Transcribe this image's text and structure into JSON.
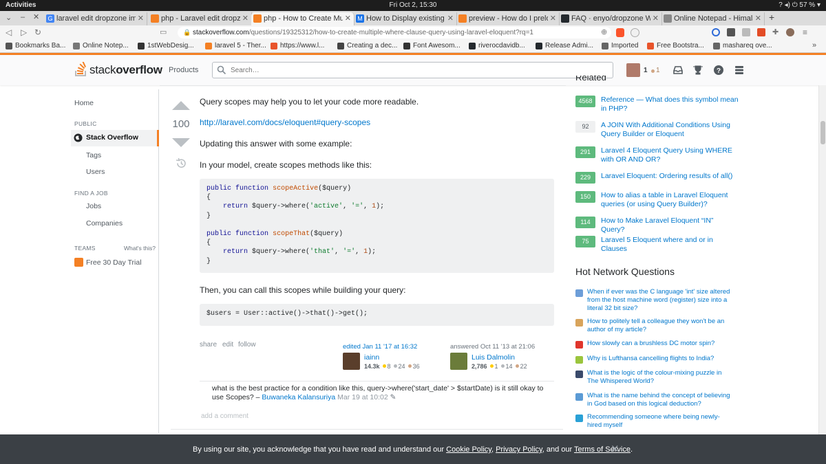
{
  "os": {
    "activities": "Activities",
    "clock": "Fri Oct  2, 15:30",
    "battery": "57 %"
  },
  "tabs": [
    {
      "label": "laravel edit dropzone imag",
      "fav_color": "#4285f4",
      "fav": "G"
    },
    {
      "label": "php - Laravel edit dropzone",
      "fav_color": "#f48024",
      "fav": ""
    },
    {
      "label": "php - How to Create Multip",
      "fav_color": "#f48024",
      "fav": ""
    },
    {
      "label": "How to Display existing fil",
      "fav_color": "#1a73e8",
      "fav": "M"
    },
    {
      "label": "preview - How do I preload",
      "fav_color": "#f48024",
      "fav": ""
    },
    {
      "label": "FAQ · enyo/dropzone Wiki",
      "fav_color": "#24292e",
      "fav": ""
    },
    {
      "label": "Online Notepad - Himalaya",
      "fav_color": "#888888",
      "fav": ""
    }
  ],
  "address": {
    "host": "stackoverflow.com",
    "path": "/questions/19325312/how-to-create-multiple-where-clause-query-using-laravel-eloquent?rq=1"
  },
  "bookmarks": [
    {
      "label": "Bookmarks Ba...",
      "color": "#555555"
    },
    {
      "label": "Online Notep...",
      "color": "#777777"
    },
    {
      "label": "1stWebDesig...",
      "color": "#333333"
    },
    {
      "label": "laravel 5 - Ther...",
      "color": "#f48024"
    },
    {
      "label": "https://www.l...",
      "color": "#e8542b"
    },
    {
      "label": "Creating a dec...",
      "color": "#444444"
    },
    {
      "label": "Font Awesom...",
      "color": "#333333"
    },
    {
      "label": "riverocdavidb...",
      "color": "#24292e"
    },
    {
      "label": "Release Admi...",
      "color": "#24292e"
    },
    {
      "label": "Imported",
      "color": "#666666"
    },
    {
      "label": "Free Bootstra...",
      "color": "#e8542b"
    },
    {
      "label": "mashareq ove...",
      "color": "#666666"
    }
  ],
  "header": {
    "logo_a": "stack",
    "logo_b": "overflow",
    "products": "Products",
    "search_placeholder": "Search…",
    "rep": "1",
    "bronze": "1"
  },
  "leftnav": {
    "home": "Home",
    "public": "PUBLIC",
    "stack_overflow": "Stack Overflow",
    "tags": "Tags",
    "users": "Users",
    "find_a_job": "FIND A JOB",
    "jobs": "Jobs",
    "companies": "Companies",
    "teams": "TEAMS",
    "whats_this": "What's this?",
    "trial": "Free 30 Day Trial"
  },
  "answer": {
    "score": "100",
    "p1": "Query scopes may help you to let your code more readable.",
    "link": "http://laravel.com/docs/eloquent#query-scopes",
    "p2": "Updating this answer with some example:",
    "p3": "In your model, create scopes methods like this:",
    "p4": "Then, you can call this scopes while building your query:",
    "code2": "$users = User::active()->that()->get();",
    "share": "share",
    "edit": "edit",
    "follow": "follow",
    "edited": "edited Jan 11 '17 at 16:32",
    "editor": {
      "name": "iainn",
      "rep": "14.3k",
      "gold": "8",
      "silver": "24",
      "bronze": "36"
    },
    "answered": "answered Oct 11 '13 at 21:06",
    "author": {
      "name": "Luis Dalmolin",
      "rep": "2,786",
      "gold": "1",
      "silver": "14",
      "bronze": "22"
    },
    "comment_text": "what is the best practice for a condition like this, query->where('start_date' > $startDate) is it still okay to use Scopes?",
    "comment_user": "Buwaneka Kalansuriya",
    "comment_date": "Mar 19 at 10:02",
    "add_comment": "add a comment"
  },
  "sidebar": {
    "related_title": "Related",
    "related": [
      {
        "score": "4568",
        "accepted": true,
        "text": "Reference — What does this symbol mean in PHP?"
      },
      {
        "score": "92",
        "accepted": false,
        "text": "A JOIN With Additional Conditions Using Query Builder or Eloquent"
      },
      {
        "score": "291",
        "accepted": true,
        "text": "Laravel 4 Eloquent Query Using WHERE with OR AND OR?"
      },
      {
        "score": "229",
        "accepted": true,
        "text": "Laravel Eloquent: Ordering results of all()"
      },
      {
        "score": "150",
        "accepted": true,
        "text": "How to alias a table in Laravel Eloquent queries (or using Query Builder)?"
      },
      {
        "score": "114",
        "accepted": true,
        "text": "How to Make Laravel Eloquent “IN” Query?"
      },
      {
        "score": "75",
        "accepted": true,
        "text": "Laravel 5 Eloquent where and or in Clauses"
      }
    ],
    "hnq_title": "Hot Network Questions",
    "hnq": [
      {
        "text": "When if ever was the C language 'int' size altered from the host machine word (register) size into a literal 32 bit size?",
        "color": "#6d9ed8"
      },
      {
        "text": "How to politely tell a colleague they won't be an author of my article?",
        "color": "#d8a45c"
      },
      {
        "text": "How slowly can a brushless DC motor spin?",
        "color": "#e0362d"
      },
      {
        "text": "Why is Lufthansa cancelling flights to India?",
        "color": "#9bc53d"
      },
      {
        "text": "What is the logic of the colour-mixing puzzle in The Whispered World?",
        "color": "#3a4a6b"
      },
      {
        "text": "What is the name behind the concept of believing in God based on this logical deduction?",
        "color": "#5b9bd5"
      },
      {
        "text": "Recommending someone where being newly-hired myself",
        "color": "#2aa1d6"
      }
    ]
  },
  "cookie": {
    "pre": "By using our site, you acknowledge that you have read and understand our ",
    "cookie_policy": "Cookie Policy",
    "sep1": ", ",
    "privacy_policy": "Privacy Policy",
    "mid": ", and our ",
    "terms": "Terms of Service",
    "end": "."
  }
}
